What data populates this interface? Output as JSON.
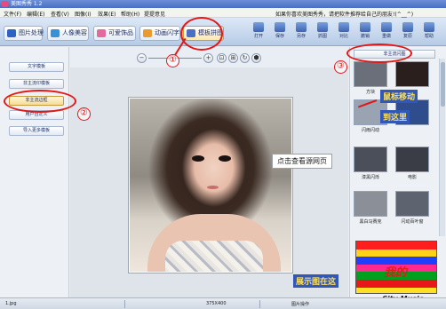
{
  "window": {
    "title": "美图秀秀 1.2"
  },
  "menubar": {
    "items": [
      "文件(F)",
      "编辑(E)",
      "查看(V)",
      "图像(I)",
      "效果(E)",
      "帮助(H)",
      "提提意见"
    ],
    "notice": "如果你喜欢美图秀秀，请把软件推荐给自己的朋友!(^__^)"
  },
  "tabs": [
    {
      "label": "图片处理",
      "color": "#2d62c4"
    },
    {
      "label": "人像美容",
      "color": "#3a8fd6"
    },
    {
      "label": "可爱饰品",
      "color": "#e36a9c"
    },
    {
      "label": "动画闪字",
      "color": "#e89c2c"
    },
    {
      "label": "模板拼图",
      "color": "#4b6ec8"
    }
  ],
  "toolbar": {
    "buttons": [
      "打开",
      "保存",
      "另存",
      "抓图",
      "对比",
      "撤销",
      "重做",
      "复原",
      "帮助"
    ]
  },
  "left_panel": {
    "buttons": [
      "文字模板",
      "非主流印模板",
      "非主流边框",
      "用户自定义",
      "导入更多模板"
    ]
  },
  "zoom": {
    "buttons": [
      "−",
      "+",
      "⊡",
      "⊞",
      "↻",
      "⬢"
    ]
  },
  "canvas": {
    "hover_tip": "点击查看源网页"
  },
  "right_panel": {
    "header": "非主流闪图",
    "thumbnails": [
      {
        "label": "方块",
        "bg": "#6b6f7a"
      },
      {
        "label": "",
        "bg": "#2a1f1d"
      },
      {
        "label": "闪雨闪动",
        "bg": "#9aa3b2"
      },
      {
        "label": "",
        "bg": "#2f4d8c"
      },
      {
        "label": "漆黑闪烁",
        "bg": "#4a4f5a"
      },
      {
        "label": "电影",
        "bg": "#3a3d46"
      },
      {
        "label": "黑白马赛克",
        "bg": "#8b8f97"
      },
      {
        "label": "闪动百叶窗",
        "bg": "#5d6470"
      }
    ],
    "preview_stripes": [
      "#ff1e1e",
      "#ffd21a",
      "#1f3fff",
      "#ff2a8e",
      "#00a01e",
      "#e81818",
      "#ffe024"
    ]
  },
  "annotations": {
    "move_note_line1": "鼠标移动",
    "move_note_line2": "到这里",
    "preview_note": "展示图在这",
    "numbers": [
      "①",
      "②",
      "③"
    ],
    "color": "#e01818"
  },
  "watermark": {
    "text": "我的",
    "music": "City Music"
  },
  "status": {
    "file": "1.jpg",
    "size": "375X400",
    "action": "图片操作"
  }
}
